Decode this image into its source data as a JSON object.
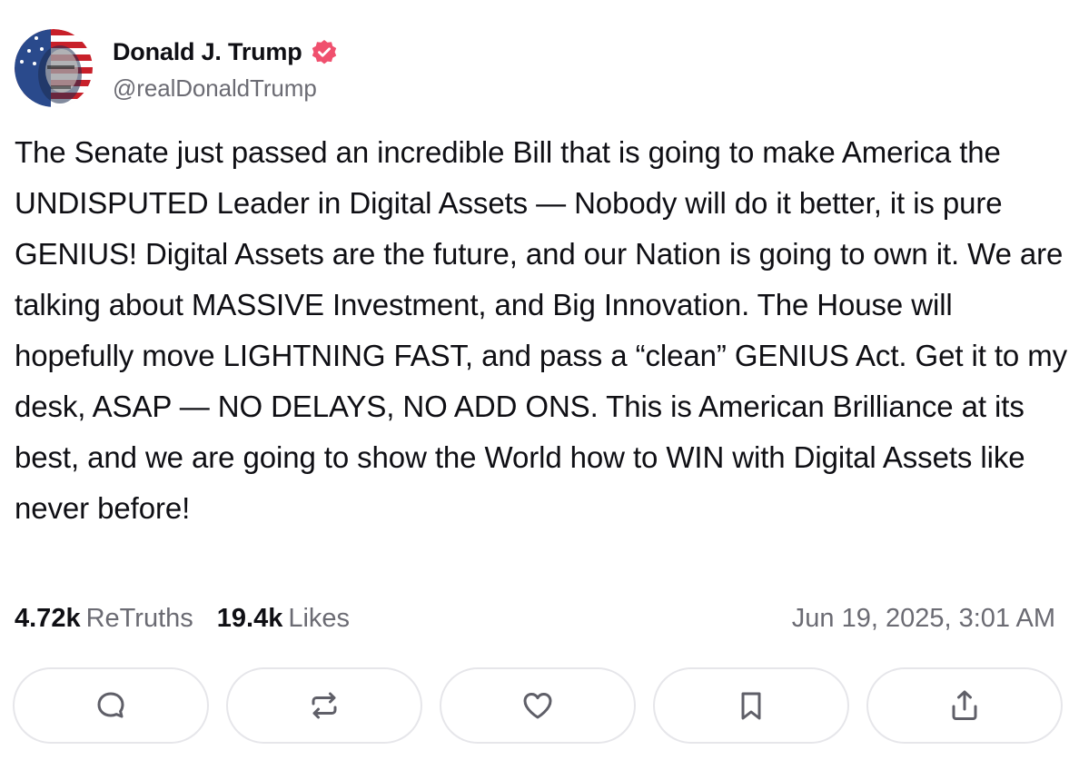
{
  "author": {
    "display_name": "Donald J. Trump",
    "handle": "@realDonaldTrump",
    "verified_color": "#f0506e",
    "avatar_icon": "avatar-flag-portrait"
  },
  "post": {
    "text": "The Senate just passed an incredible Bill that is going to make America the UNDISPUTED Leader in Digital Assets — Nobody will do it better, it is pure GENIUS! Digital Assets are the future, and our Nation is going to own it. We are talking about MASSIVE Investment, and Big Innovation. The House will hopefully move LIGHTNING FAST, and pass a “clean” GENIUS Act. Get it to my desk, ASAP — NO DELAYS, NO ADD ONS. This is American Brilliance at its best, and we are going to show the World how to WIN with Digital Assets like never before!"
  },
  "stats": {
    "retruths_count": "4.72k",
    "retruths_label": "ReTruths",
    "likes_count": "19.4k",
    "likes_label": "Likes",
    "timestamp": "Jun 19, 2025, 3:01 AM"
  },
  "actions": [
    {
      "icon": "reply-icon"
    },
    {
      "icon": "retruth-icon"
    },
    {
      "icon": "like-icon"
    },
    {
      "icon": "bookmark-icon"
    },
    {
      "icon": "share-icon"
    }
  ],
  "colors": {
    "text_primary": "#0f0f14",
    "text_secondary": "#6b6b73",
    "icon": "#5f5f68",
    "button_border": "#e6e6ea"
  }
}
